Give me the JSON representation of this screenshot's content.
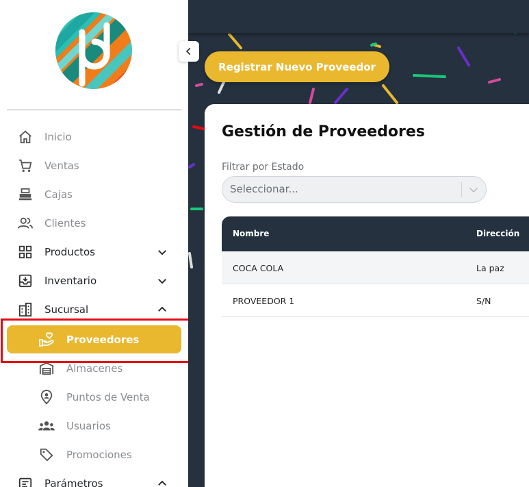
{
  "sidebar": {
    "items": [
      {
        "label": "Inicio",
        "icon": "home-icon"
      },
      {
        "label": "Ventas",
        "icon": "cart-icon"
      },
      {
        "label": "Cajas",
        "icon": "cash-register-icon"
      },
      {
        "label": "Clientes",
        "icon": "users-icon"
      },
      {
        "label": "Productos",
        "icon": "grid-icon"
      },
      {
        "label": "Inventario",
        "icon": "inventory-icon"
      },
      {
        "label": "Sucursal",
        "icon": "building-icon"
      }
    ],
    "sub_items": [
      {
        "label": "Proveedores",
        "icon": "hand-heart-icon"
      },
      {
        "label": "Almacenes",
        "icon": "warehouse-icon"
      },
      {
        "label": "Puntos de Venta",
        "icon": "location-pin-icon"
      },
      {
        "label": "Usuarios",
        "icon": "group-icon"
      },
      {
        "label": "Promociones",
        "icon": "tag-icon"
      }
    ],
    "bottom_item": {
      "label": "Parámetros",
      "icon": "settings-list-icon"
    }
  },
  "main": {
    "register_button": "Registrar Nuevo Proveedor",
    "title": "Gestión de Proveedores",
    "filter": {
      "label": "Filtrar por Estado",
      "placeholder": "Seleccionar..."
    },
    "table": {
      "headers": [
        "Nombre",
        "Dirección"
      ],
      "rows": [
        [
          "COCA COLA",
          "La paz"
        ],
        [
          "PROVEEDOR 1",
          "S/N"
        ]
      ]
    }
  },
  "colors": {
    "accent": "#e9b82f",
    "dark": "#25313f",
    "highlight": "#e50914"
  }
}
